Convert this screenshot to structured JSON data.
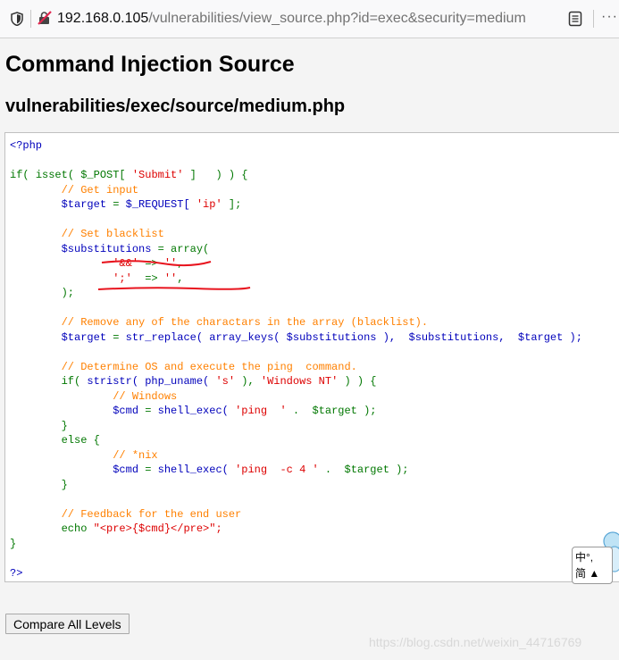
{
  "browser": {
    "url_host": "192.168.0.105",
    "url_path": "/vulnerabilities/view_source.php?id=exec&security=medium",
    "more_label": "···"
  },
  "page": {
    "title": "Command Injection Source",
    "file_path": "vulnerabilities/exec/source/medium.php"
  },
  "code": {
    "open_tag": "<?php",
    "line_if": "isset( $_POST[ ",
    "submit": "'Submit'",
    "line_if_end": " ]   ) ) {",
    "c_input": "// Get input",
    "target_var": "$target",
    "request": "$_REQUEST[ ",
    "ip": "'ip'",
    "request_end": " ];",
    "c_blacklist": "// Set blacklist",
    "subst_var": "$substitutions",
    "array_kw": "array(",
    "amp": "'&&'",
    "arrow": "=>",
    "empty": "''",
    "semi": "';'",
    "close_arr": ");",
    "c_remove": "// Remove any of the charactars in the array (blacklist).",
    "str_replace": "str_replace( array_keys( $substitutions ),  $substitutions,  $target );",
    "c_os": "// Determine OS and execute the ping  command.",
    "stristr": "stristr( php_uname( ",
    "s_arg": "'s'",
    "win_nt": "'Windows NT'",
    "c_windows": "// Windows",
    "cmd_var": "$cmd",
    "shell_exec": "shell_exec( ",
    "ping": "'ping  '",
    "dot_target": " .  $target );",
    "else_kw": "else",
    "c_nix": "// *nix",
    "ping_c4": "'ping  -c 4 '",
    "c_feedback": "// Feedback for the end user",
    "echo_kw": "echo",
    "echo_str": "\"<pre>{$cmd}</pre>\";",
    "close_tag": "?>"
  },
  "ime": {
    "line1": "中°,",
    "line2": "简"
  },
  "footer": {
    "compare_button": "Compare All Levels",
    "watermark": "https://blog.csdn.net/weixin_44716769"
  },
  "colors": {
    "keyword": "#007700",
    "string": "#dd0000",
    "comment": "#ff8000",
    "default": "#0000bb",
    "annotation": "#e8141e"
  }
}
